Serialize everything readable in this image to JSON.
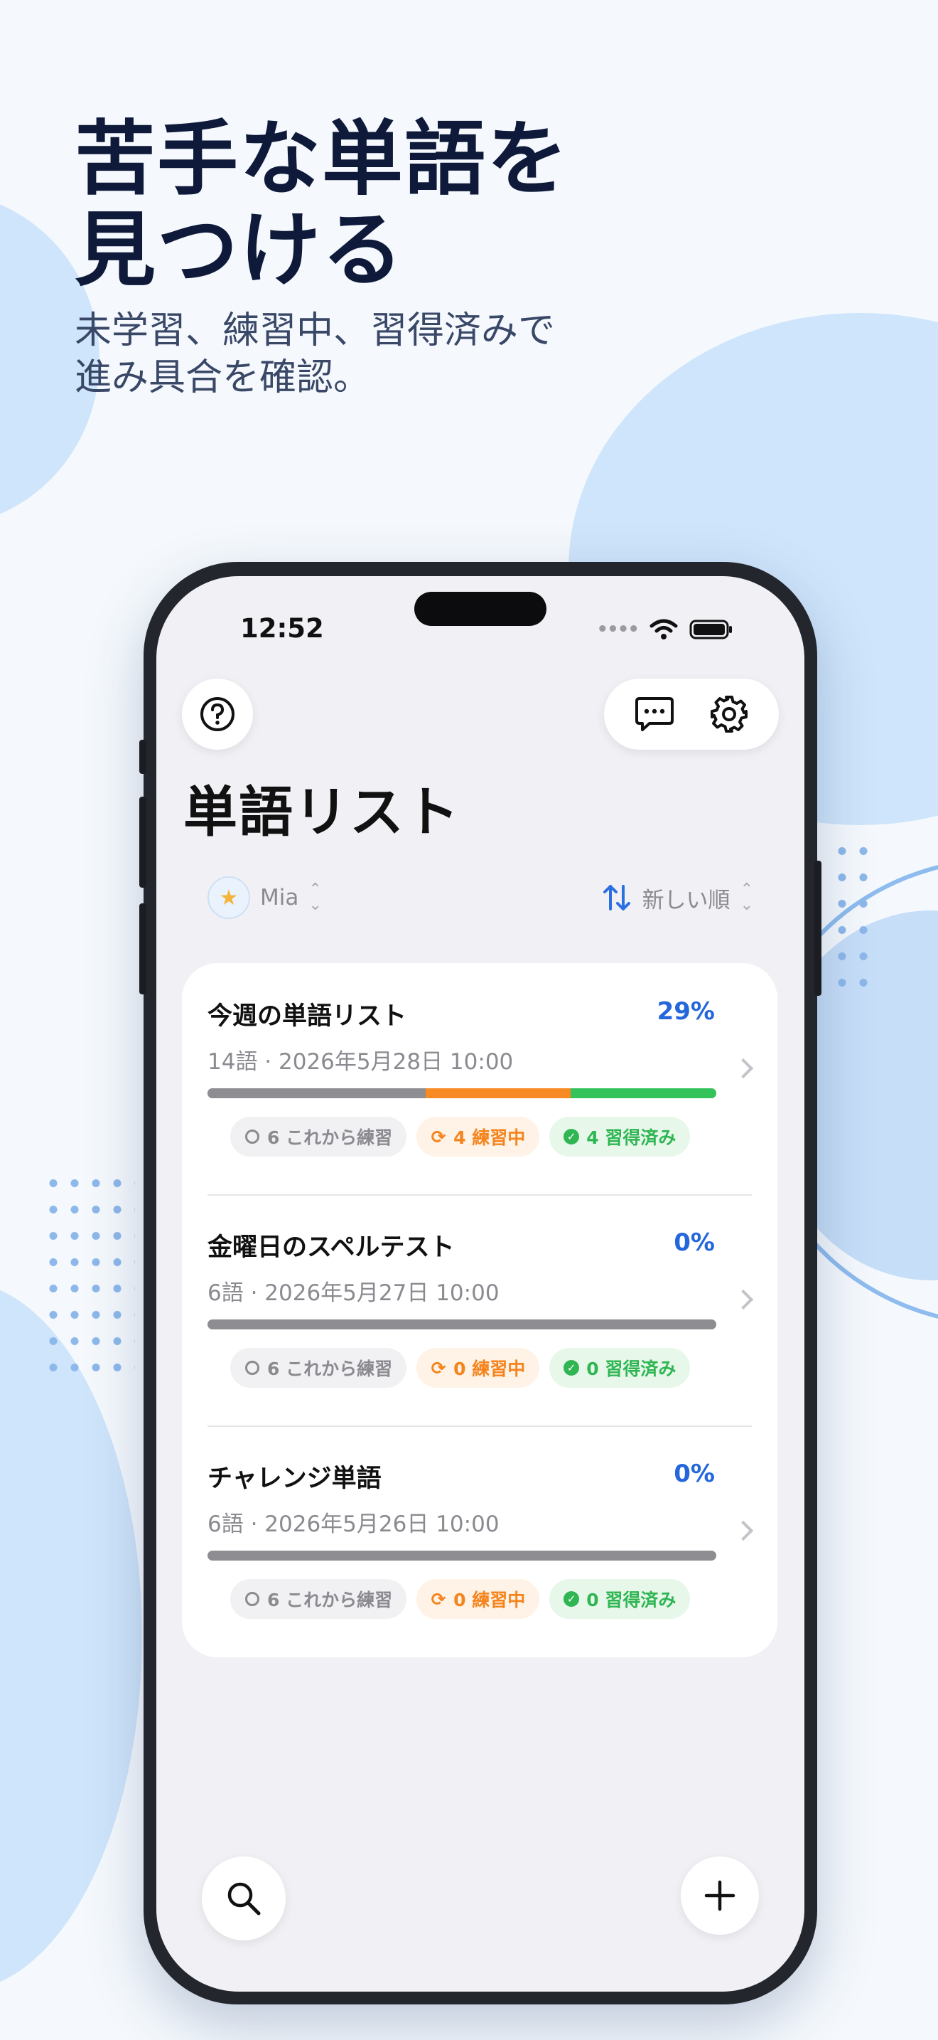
{
  "promo": {
    "headline": "苦手な単語を\n見つける",
    "subline": "未学習、練習中、習得済みで\n進み具合を確認。"
  },
  "status_bar": {
    "time": "12:52"
  },
  "app": {
    "page_title": "単語リスト",
    "user_name": "Mia",
    "sort_label": "新しい順",
    "lists": [
      {
        "title": "今週の単語リスト",
        "percent": "29%",
        "meta": "14語 · 2026年5月28日 10:00",
        "progress": {
          "unpracticed": 6,
          "practicing": 4,
          "mastered": 4
        },
        "chips": {
          "unpracticed": "6 これから練習",
          "practicing": "4 練習中",
          "mastered": "4 習得済み"
        }
      },
      {
        "title": "金曜日のスペルテスト",
        "percent": "0%",
        "meta": "6語 · 2026年5月27日 10:00",
        "progress": {
          "unpracticed": 6,
          "practicing": 0,
          "mastered": 0
        },
        "chips": {
          "unpracticed": "6 これから練習",
          "practicing": "0 練習中",
          "mastered": "0 習得済み"
        }
      },
      {
        "title": "チャレンジ単語",
        "percent": "0%",
        "meta": "6語 · 2026年5月26日 10:00",
        "progress": {
          "unpracticed": 6,
          "practicing": 0,
          "mastered": 0
        },
        "chips": {
          "unpracticed": "6 これから練習",
          "practicing": "0 練習中",
          "mastered": "0 習得済み"
        }
      }
    ]
  },
  "icons": {
    "help": "question-circle-icon",
    "chat": "chat-bubble-icon",
    "settings": "gear-icon",
    "sort": "sort-arrows-icon",
    "search": "search-icon",
    "add": "plus-icon"
  },
  "colors": {
    "accent": "#2466dc",
    "unpracticed": "#8d8d92",
    "practicing": "#f78a23",
    "mastered": "#34c35a"
  }
}
